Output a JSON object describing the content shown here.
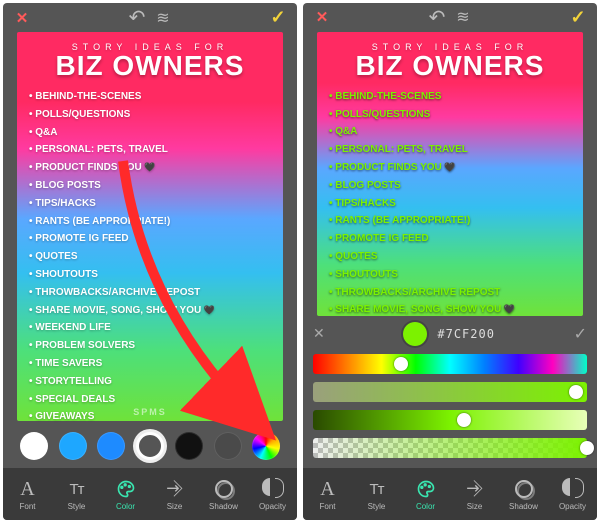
{
  "toolbar_tabs": {
    "font": "Font",
    "style": "Style",
    "color": "Color",
    "size": "Size",
    "shadow": "Shadow",
    "opacity": "Opacity"
  },
  "story_graphic": {
    "subtitle": "STORY IDEAS FOR",
    "title": "BIZ OWNERS",
    "watermark": "SPMS",
    "items": [
      {
        "text": "BEHIND-THE-SCENES"
      },
      {
        "text": "POLLS/QUESTIONS"
      },
      {
        "text": "Q&A"
      },
      {
        "text": "PERSONAL: PETS, TRAVEL"
      },
      {
        "text": "PRODUCT FINDS YOU",
        "heart": true
      },
      {
        "text": "BLOG POSTS"
      },
      {
        "text": "TIPS/HACKS"
      },
      {
        "text": "RANTS (BE APPROPRIATE!)"
      },
      {
        "text": "PROMOTE IG FEED"
      },
      {
        "text": "QUOTES"
      },
      {
        "text": "SHOUTOUTS"
      },
      {
        "text": "THROWBACKS/ARCHIVE REPOST"
      },
      {
        "text": "SHARE MOVIE, SONG, SHOW YOU",
        "heart": true
      },
      {
        "text": "WEEKEND LIFE"
      },
      {
        "text": "PROBLEM SOLVERS"
      },
      {
        "text": "TIME SAVERS"
      },
      {
        "text": "STORYTELLING"
      },
      {
        "text": "SPECIAL DEALS"
      },
      {
        "text": "GIVEAWAYS"
      }
    ]
  },
  "left_panel": {
    "swatches": [
      {
        "name": "white",
        "color": "#ffffff",
        "selected": false
      },
      {
        "name": "blue-1",
        "color": "#1ea7ff",
        "selected": false
      },
      {
        "name": "blue-2",
        "color": "#1e8bff",
        "selected": false
      },
      {
        "name": "outline",
        "color": "#555555",
        "selected": true,
        "ring": true
      },
      {
        "name": "black",
        "color": "#111111",
        "selected": false
      },
      {
        "name": "gray",
        "color": "#4a4a4a",
        "selected": false
      },
      {
        "name": "rainbow",
        "color": "rainbow",
        "selected": false
      }
    ],
    "visible_items": 19
  },
  "right_panel": {
    "visible_items": 13,
    "picker": {
      "hex_prefix": "#",
      "hex_value": "7CF200",
      "current_color": "#7CF200",
      "hue_knob_pct": 32,
      "sat_knob_pct": 96,
      "light_knob_pct": 55,
      "alpha_knob_pct": 100
    }
  },
  "colors": {
    "accent_tab": "#39e6b0",
    "picked": "#7CF200"
  }
}
